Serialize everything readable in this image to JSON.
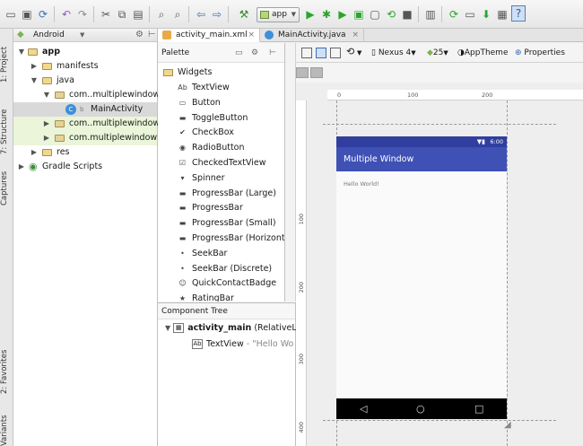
{
  "toolbar": {
    "run_config": "app"
  },
  "left_strip": {
    "tabs": [
      "1: Project",
      "7: Structure",
      "Captures",
      "2: Favorites",
      "Variants"
    ]
  },
  "project": {
    "view": "Android",
    "tree": [
      {
        "label": "app"
      },
      {
        "label": "manifests"
      },
      {
        "label": "java"
      },
      {
        "label": "com..multiplewindow"
      },
      {
        "label": "MainActivity"
      },
      {
        "label": "com..multiplewindow"
      },
      {
        "label": "com.multiplewindow"
      },
      {
        "label": "res"
      },
      {
        "label": "Gradle Scripts"
      }
    ]
  },
  "tabs": [
    {
      "label": "activity_main.xml"
    },
    {
      "label": "MainActivity.java"
    }
  ],
  "palette": {
    "title": "Palette",
    "group": "Widgets",
    "items": [
      {
        "label": "TextView",
        "icon": "Ab"
      },
      {
        "label": "Button",
        "icon": "▭"
      },
      {
        "label": "ToggleButton",
        "icon": "▬"
      },
      {
        "label": "CheckBox",
        "icon": "✔"
      },
      {
        "label": "RadioButton",
        "icon": "◉"
      },
      {
        "label": "CheckedTextView",
        "icon": "☑"
      },
      {
        "label": "Spinner",
        "icon": "▾"
      },
      {
        "label": "ProgressBar (Large)",
        "icon": "▬"
      },
      {
        "label": "ProgressBar",
        "icon": "▬"
      },
      {
        "label": "ProgressBar (Small)",
        "icon": "▬"
      },
      {
        "label": "ProgressBar (Horizontal)",
        "icon": "▬"
      },
      {
        "label": "SeekBar",
        "icon": "•"
      },
      {
        "label": "SeekBar (Discrete)",
        "icon": "•"
      },
      {
        "label": "QuickContactBadge",
        "icon": "☺"
      },
      {
        "label": "RatingBar",
        "icon": "★"
      }
    ]
  },
  "component_tree": {
    "title": "Component Tree",
    "root_name": "activity_main",
    "root_type": "(RelativeLa",
    "child_name": "TextView",
    "child_value": "- \"Hello Wo"
  },
  "design_toolbar": {
    "device": "Nexus 4",
    "api": "25",
    "theme": "AppTheme",
    "properties": "Properties"
  },
  "canvas": {
    "ruler_top": [
      "0",
      "100",
      "200"
    ],
    "ruler_left": [
      "100",
      "200",
      "300",
      "400"
    ]
  },
  "device": {
    "time": "6:00",
    "app_title": "Multiple Window",
    "hello_text": "Hello World!",
    "nav_back": "◁",
    "nav_home": "○",
    "nav_recent": "□"
  },
  "colors": {
    "status_bar": "#303f9f",
    "app_bar": "#3f51b5",
    "run_green": "#2aa52a"
  }
}
